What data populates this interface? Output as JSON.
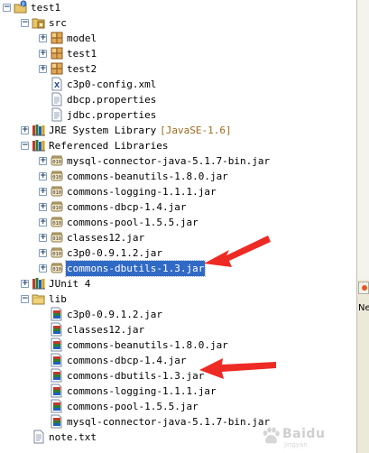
{
  "tree": [
    {
      "name": "project-test1",
      "label": "test1",
      "depth": 0,
      "toggle": "-",
      "icon": "project-icon",
      "interactable": true
    },
    {
      "name": "src-folder",
      "label": "src",
      "depth": 1,
      "toggle": "-",
      "icon": "source-folder-icon",
      "interactable": true
    },
    {
      "name": "package-model",
      "label": "model",
      "depth": 2,
      "toggle": "+",
      "icon": "package-icon",
      "interactable": true
    },
    {
      "name": "package-test1",
      "label": "test1",
      "depth": 2,
      "toggle": "+",
      "icon": "package-icon",
      "interactable": true
    },
    {
      "name": "package-test2",
      "label": "test2",
      "depth": 2,
      "toggle": "+",
      "icon": "package-icon",
      "interactable": true
    },
    {
      "name": "file-c3p0-config-xml",
      "label": "c3p0-config.xml",
      "depth": 2,
      "toggle": "",
      "icon": "xml-file-icon",
      "interactable": true
    },
    {
      "name": "file-dbcp-properties",
      "label": "dbcp.properties",
      "depth": 2,
      "toggle": "",
      "icon": "text-file-icon",
      "interactable": true
    },
    {
      "name": "file-jdbc-properties",
      "label": "jdbc.properties",
      "depth": 2,
      "toggle": "",
      "icon": "text-file-icon",
      "interactable": true
    },
    {
      "name": "jre-system-library",
      "label": "JRE System Library",
      "decoration": "[JavaSE-1.6]",
      "depth": 1,
      "toggle": "+",
      "icon": "library-icon",
      "interactable": true
    },
    {
      "name": "referenced-libraries",
      "label": "Referenced Libraries",
      "depth": 1,
      "toggle": "-",
      "icon": "library-icon",
      "interactable": true
    },
    {
      "name": "ref-jar-mysql-connector",
      "label": "mysql-connector-java-5.1.7-bin.jar",
      "depth": 2,
      "toggle": "+",
      "icon": "jar-icon",
      "interactable": true
    },
    {
      "name": "ref-jar-commons-beanutils",
      "label": "commons-beanutils-1.8.0.jar",
      "depth": 2,
      "toggle": "+",
      "icon": "jar-icon",
      "interactable": true
    },
    {
      "name": "ref-jar-commons-logging",
      "label": "commons-logging-1.1.1.jar",
      "depth": 2,
      "toggle": "+",
      "icon": "jar-icon",
      "interactable": true
    },
    {
      "name": "ref-jar-commons-dbcp",
      "label": "commons-dbcp-1.4.jar",
      "depth": 2,
      "toggle": "+",
      "icon": "jar-icon",
      "interactable": true
    },
    {
      "name": "ref-jar-commons-pool",
      "label": "commons-pool-1.5.5.jar",
      "depth": 2,
      "toggle": "+",
      "icon": "jar-icon",
      "interactable": true
    },
    {
      "name": "ref-jar-classes12",
      "label": "classes12.jar",
      "depth": 2,
      "toggle": "+",
      "icon": "jar-icon",
      "interactable": true
    },
    {
      "name": "ref-jar-c3p0",
      "label": "c3p0-0.9.1.2.jar",
      "depth": 2,
      "toggle": "+",
      "icon": "jar-icon",
      "interactable": true
    },
    {
      "name": "ref-jar-commons-dbutils",
      "label": "commons-dbutils-1.3.jar",
      "depth": 2,
      "toggle": "+",
      "icon": "jar-icon",
      "interactable": true,
      "selected": true
    },
    {
      "name": "junit-4-library",
      "label": "JUnit 4",
      "depth": 1,
      "toggle": "+",
      "icon": "library-icon",
      "interactable": true
    },
    {
      "name": "lib-folder",
      "label": "lib",
      "depth": 1,
      "toggle": "-",
      "icon": "folder-icon",
      "interactable": true
    },
    {
      "name": "lib-jar-c3p0",
      "label": "c3p0-0.9.1.2.jar",
      "depth": 2,
      "toggle": "",
      "icon": "jar-file-icon",
      "interactable": true
    },
    {
      "name": "lib-jar-classes12",
      "label": "classes12.jar",
      "depth": 2,
      "toggle": "",
      "icon": "jar-file-icon",
      "interactable": true
    },
    {
      "name": "lib-jar-commons-beanutils",
      "label": "commons-beanutils-1.8.0.jar",
      "depth": 2,
      "toggle": "",
      "icon": "jar-file-icon",
      "interactable": true
    },
    {
      "name": "lib-jar-commons-dbcp",
      "label": "commons-dbcp-1.4.jar",
      "depth": 2,
      "toggle": "",
      "icon": "jar-file-icon",
      "interactable": true
    },
    {
      "name": "lib-jar-commons-dbutils",
      "label": "commons-dbutils-1.3.jar",
      "depth": 2,
      "toggle": "",
      "icon": "jar-file-icon",
      "interactable": true
    },
    {
      "name": "lib-jar-commons-logging",
      "label": "commons-logging-1.1.1.jar",
      "depth": 2,
      "toggle": "",
      "icon": "jar-file-icon",
      "interactable": true
    },
    {
      "name": "lib-jar-commons-pool",
      "label": "commons-pool-1.5.5.jar",
      "depth": 2,
      "toggle": "",
      "icon": "jar-file-icon",
      "interactable": true
    },
    {
      "name": "lib-jar-mysql-connector",
      "label": "mysql-connector-java-5.1.7-bin.jar",
      "depth": 2,
      "toggle": "",
      "icon": "jar-file-icon",
      "interactable": true
    },
    {
      "name": "file-note-txt",
      "label": "note.txt",
      "depth": 1,
      "toggle": "",
      "icon": "text-file-icon",
      "interactable": true
    }
  ],
  "right_panel": {
    "text": "Ne"
  },
  "watermark": {
    "text": "Baidu",
    "sub": "jingyan"
  },
  "colors": {
    "selection": "#316ac5",
    "arrow": "#ee2a24",
    "decoration": "#9c6a1e"
  }
}
